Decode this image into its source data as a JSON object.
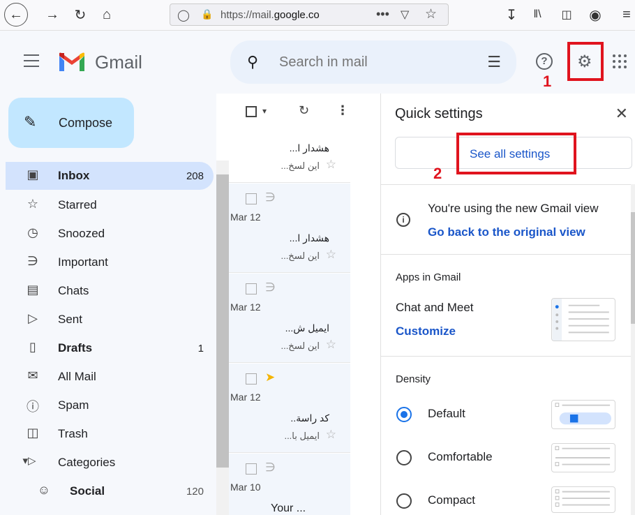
{
  "browser": {
    "url_prefix": "https://mail.",
    "url_domain": "google.co",
    "more_dots": "•••"
  },
  "header": {
    "app_name": "Gmail",
    "search_placeholder": "Search in mail"
  },
  "annotations": {
    "step1": "1",
    "step2": "2",
    "highlight_color": "#e0141e"
  },
  "sidebar": {
    "compose_label": "Compose",
    "items": [
      {
        "label": "Inbox",
        "count": "208",
        "icon": "inbox-icon"
      },
      {
        "label": "Starred",
        "count": "",
        "icon": "star-icon"
      },
      {
        "label": "Snoozed",
        "count": "",
        "icon": "clock-icon"
      },
      {
        "label": "Important",
        "count": "",
        "icon": "important-icon"
      },
      {
        "label": "Chats",
        "count": "",
        "icon": "chat-icon"
      },
      {
        "label": "Sent",
        "count": "",
        "icon": "send-icon"
      },
      {
        "label": "Drafts",
        "count": "1",
        "icon": "draft-icon"
      },
      {
        "label": "All Mail",
        "count": "",
        "icon": "all-mail-icon"
      },
      {
        "label": "Spam",
        "count": "",
        "icon": "spam-icon"
      },
      {
        "label": "Trash",
        "count": "",
        "icon": "trash-icon"
      },
      {
        "label": "Categories",
        "count": "",
        "icon": "label-icon"
      },
      {
        "label": "Social",
        "count": "120",
        "icon": "people-icon"
      }
    ]
  },
  "mail_list": {
    "rows": [
      {
        "date": "Mar 12",
        "sender": "هشدار ا...",
        "snippet": "این لسخ..."
      },
      {
        "date": "Mar 12",
        "sender": "هشدار ا...",
        "snippet": "این لسخ..."
      },
      {
        "date": "Mar 12",
        "sender": "ایمیل ش...",
        "snippet": "این لسخ..."
      },
      {
        "date": "Mar 12",
        "sender": "کد راسة..",
        "snippet": "ایمیل با..."
      },
      {
        "date": "Mar 10",
        "sender": "Your ...",
        "snippet": ""
      }
    ]
  },
  "quick_settings": {
    "title": "Quick settings",
    "see_all": "See all settings",
    "new_view_text": "You're using the new Gmail view",
    "go_back_link": "Go back to the original view",
    "apps_heading": "Apps in Gmail",
    "chat_meet": "Chat and Meet",
    "customize": "Customize",
    "density_heading": "Density",
    "density_options": [
      {
        "label": "Default",
        "selected": true
      },
      {
        "label": "Comfortable",
        "selected": false
      },
      {
        "label": "Compact",
        "selected": false
      }
    ]
  }
}
